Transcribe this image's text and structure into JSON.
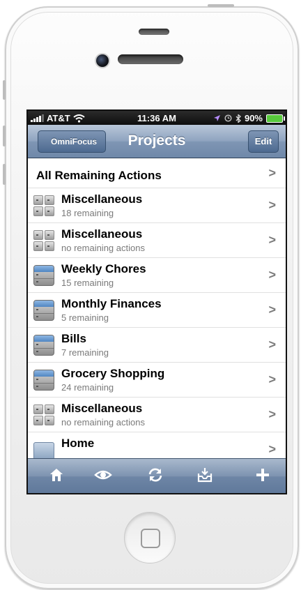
{
  "status": {
    "carrier": "AT&T",
    "time": "11:36 AM",
    "battery": "90%"
  },
  "nav": {
    "back_label": "OmniFocus",
    "title": "Projects",
    "edit_label": "Edit"
  },
  "rows": [
    {
      "name": "All Remaining Actions",
      "sub": "",
      "icon": "none"
    },
    {
      "name": "Miscellaneous",
      "sub": "18 remaining",
      "icon": "drawer-grid-icon"
    },
    {
      "name": "Miscellaneous",
      "sub": "no remaining actions",
      "icon": "drawer-grid-icon"
    },
    {
      "name": "Weekly Chores",
      "sub": "15 remaining",
      "icon": "cabinet-icon"
    },
    {
      "name": "Monthly Finances",
      "sub": "5 remaining",
      "icon": "cabinet-icon"
    },
    {
      "name": "Bills",
      "sub": "7 remaining",
      "icon": "cabinet-icon"
    },
    {
      "name": "Grocery Shopping",
      "sub": "24 remaining",
      "icon": "cabinet-icon"
    },
    {
      "name": "Miscellaneous",
      "sub": "no remaining actions",
      "icon": "drawer-grid-icon"
    },
    {
      "name": "Home",
      "sub": "",
      "icon": "folder-icon"
    }
  ],
  "toolbar": {
    "items": [
      "home-icon",
      "eye-icon",
      "sync-icon",
      "inbox-icon",
      "add-icon"
    ]
  },
  "colors": {
    "nav_top": "#b9c7d9",
    "nav_bottom": "#6f88a9",
    "battery_fill": "#57c93b"
  }
}
